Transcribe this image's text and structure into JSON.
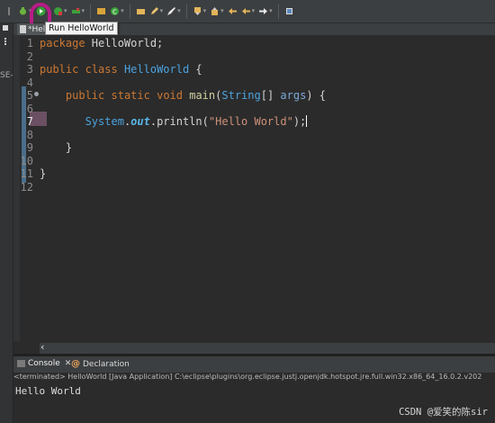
{
  "editor": {
    "tab_label": "*Hell",
    "tooltip": "Run HelloWorld",
    "lines": [
      {
        "n": "1",
        "fold": false,
        "cur": false,
        "parts": [
          {
            "t": "package",
            "c": "kw"
          },
          {
            "t": " HelloWorld;",
            "c": "pl"
          }
        ]
      },
      {
        "n": "2",
        "fold": false,
        "cur": false,
        "parts": []
      },
      {
        "n": "3",
        "fold": false,
        "cur": false,
        "parts": [
          {
            "t": "public",
            "c": "kw"
          },
          {
            "t": " ",
            "c": "pl"
          },
          {
            "t": "class",
            "c": "kw"
          },
          {
            "t": " ",
            "c": "pl"
          },
          {
            "t": "HelloWorld",
            "c": "cls"
          },
          {
            "t": " {",
            "c": "pl"
          }
        ]
      },
      {
        "n": "4",
        "fold": false,
        "cur": false,
        "parts": []
      },
      {
        "n": "5",
        "fold": true,
        "cur": false,
        "parts": [
          {
            "t": "    ",
            "c": "pl"
          },
          {
            "t": "public",
            "c": "kw"
          },
          {
            "t": " ",
            "c": "pl"
          },
          {
            "t": "static",
            "c": "kw"
          },
          {
            "t": " ",
            "c": "pl"
          },
          {
            "t": "void",
            "c": "kw"
          },
          {
            "t": " ",
            "c": "pl"
          },
          {
            "t": "main",
            "c": "fn"
          },
          {
            "t": "(",
            "c": "pl"
          },
          {
            "t": "String",
            "c": "ty"
          },
          {
            "t": "[] ",
            "c": "pl"
          },
          {
            "t": "args",
            "c": "par"
          },
          {
            "t": ") {",
            "c": "pl"
          }
        ]
      },
      {
        "n": "6",
        "fold": false,
        "cur": false,
        "parts": []
      },
      {
        "n": "7",
        "fold": false,
        "cur": true,
        "parts": [
          {
            "t": "       ",
            "c": "pl"
          },
          {
            "t": "System",
            "c": "ty"
          },
          {
            "t": ".",
            "c": "pl"
          },
          {
            "t": "out",
            "c": "it"
          },
          {
            "t": ".println(",
            "c": "pl"
          },
          {
            "t": "\"Hello World\"",
            "c": "str"
          },
          {
            "t": ");",
            "c": "pl"
          }
        ]
      },
      {
        "n": "8",
        "fold": false,
        "cur": false,
        "parts": []
      },
      {
        "n": "9",
        "fold": false,
        "cur": false,
        "parts": [
          {
            "t": "    }",
            "c": "pl"
          }
        ]
      },
      {
        "n": "10",
        "fold": false,
        "cur": false,
        "parts": []
      },
      {
        "n": "11",
        "fold": false,
        "cur": false,
        "parts": [
          {
            "t": "}",
            "c": "pl"
          }
        ]
      },
      {
        "n": "12",
        "fold": false,
        "cur": false,
        "parts": []
      }
    ]
  },
  "side": {
    "label": "SE-"
  },
  "console": {
    "tab_console": "Console",
    "tab_close": "✕",
    "tab_declaration": "Declaration",
    "header": "<terminated> HelloWorld [Java Application] C:\\eclipse\\plugins\\org.eclipse.justj.openjdk.hotspot.jre.full.win32.x86_64_16.0.2.v202",
    "output": "Hello World"
  },
  "watermark": "CSDN @爱笑的陈sir",
  "colors": {
    "highlight": "#b61c86",
    "keyword": "#cc7832",
    "type": "#4aa3e0",
    "string": "#ce9178"
  }
}
